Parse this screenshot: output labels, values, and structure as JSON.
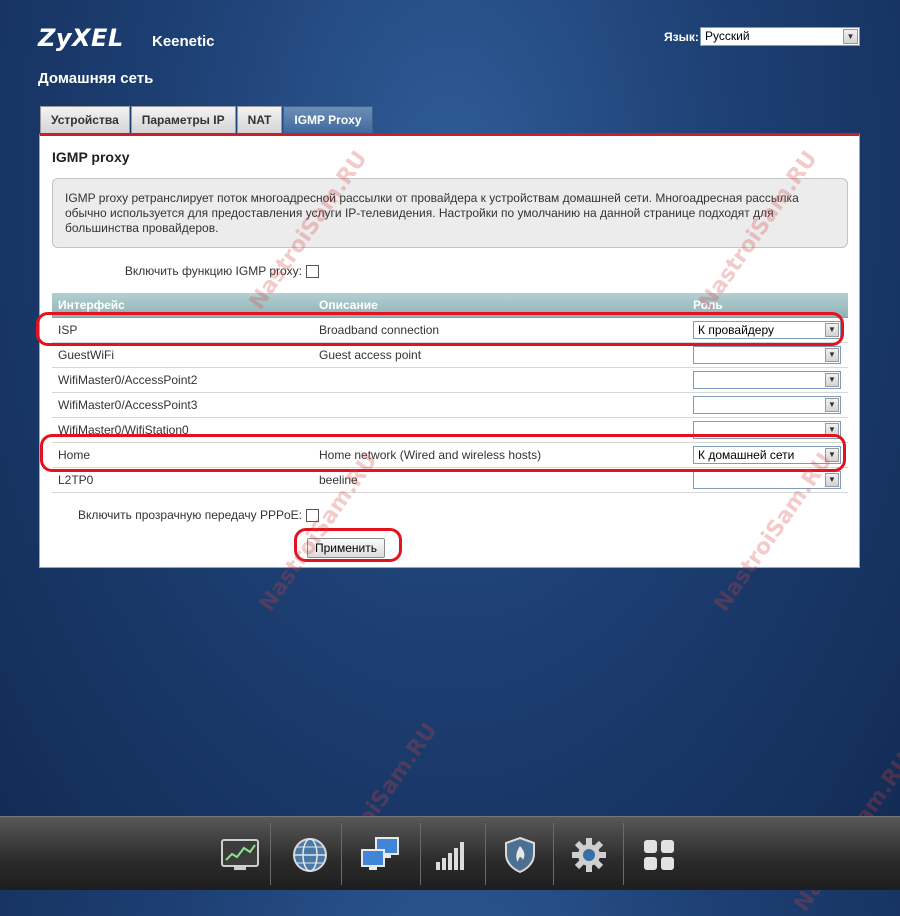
{
  "header": {
    "brand": "ZyXEL",
    "product": "Keenetic",
    "language_label": "Язык:",
    "language_value": "Русский",
    "page_title": "Домашняя сеть"
  },
  "tabs": [
    {
      "label": "Устройства",
      "active": false
    },
    {
      "label": "Параметры IP",
      "active": false
    },
    {
      "label": "NAT",
      "active": false
    },
    {
      "label": "IGMP Proxy",
      "active": true
    }
  ],
  "panel": {
    "title": "IGMP proxy",
    "info": "IGMP proxy ретранслирует поток многоадресной рассылки от провайдера к устройствам домашней сети. Многоадресная рассылка обычно используется для предоставления услуги IP-телевидения. Настройки по умолчанию на данной странице подходят для большинства провайдеров.",
    "enable_label": "Включить функцию IGMP proxy:",
    "enable_checked": false,
    "table": {
      "headers": [
        "Интерфейс",
        "Описание",
        "Роль"
      ],
      "rows": [
        {
          "interface": "ISP",
          "description": "Broadband connection",
          "role": "К провайдеру"
        },
        {
          "interface": "GuestWiFi",
          "description": "Guest access point",
          "role": ""
        },
        {
          "interface": "WifiMaster0/AccessPoint2",
          "description": "",
          "role": ""
        },
        {
          "interface": "WifiMaster0/AccessPoint3",
          "description": "",
          "role": ""
        },
        {
          "interface": "WifiMaster0/WifiStation0",
          "description": "",
          "role": ""
        },
        {
          "interface": "Home",
          "description": "Home network (Wired and wireless hosts)",
          "role": "К домашней сети"
        },
        {
          "interface": "L2TP0",
          "description": "beeline",
          "role": ""
        }
      ]
    },
    "pppoe_label": "Включить прозрачную передачу PPPoE:",
    "pppoe_checked": false,
    "apply_label": "Применить"
  },
  "watermark": "NastroiSam.RU",
  "dock": {
    "items": [
      {
        "name": "monitor-icon",
        "active": false
      },
      {
        "name": "internet-globe-icon",
        "active": false
      },
      {
        "name": "home-network-icon",
        "active": true
      },
      {
        "name": "wifi-signal-icon",
        "active": false
      },
      {
        "name": "security-shield-icon",
        "active": false
      },
      {
        "name": "system-gear-icon",
        "active": false
      },
      {
        "name": "apps-grid-icon",
        "active": false
      }
    ]
  },
  "colors": {
    "background": "#1d3f73",
    "accent_red": "#c8202b",
    "highlight": "#e3121e",
    "active_tab": "#4f78a8",
    "table_header": "#9dbfc2"
  }
}
